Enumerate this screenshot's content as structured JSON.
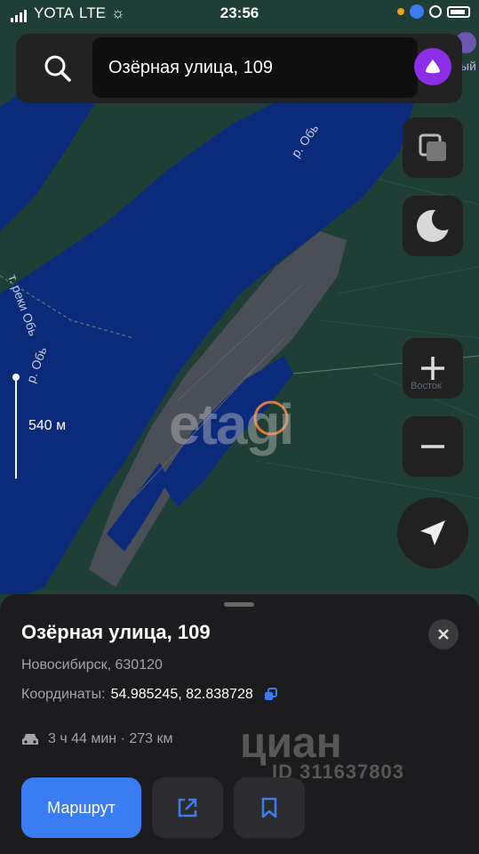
{
  "status_bar": {
    "carrier": "YOTA",
    "network": "LTE",
    "time": "23:56"
  },
  "search": {
    "value": "Озёрная улица, 109"
  },
  "map": {
    "scale_label": "540 м",
    "river_labels": [
      "р. Обь",
      "т. реки Обь",
      "р. Обь"
    ],
    "watermark": "etagi",
    "partial_label_right": "ый",
    "partial_label_east": "Восток"
  },
  "sheet": {
    "title": "Озёрная улица, 109",
    "address": "Новосибирск, 630120",
    "coords_label": "Координаты:",
    "coords_value": "54.985245, 82.838728",
    "route_info": "3 ч 44 мин · 273 км",
    "route_button": "Маршрут",
    "watermark_brand": "циан",
    "watermark_id": "ID 311637803"
  },
  "colors": {
    "water": "#0b2a7a",
    "land": "#1f3f36",
    "accent_blue": "#3a7cf2",
    "marker": "#e07a3a",
    "alice_purple": "#8b2ee6"
  }
}
